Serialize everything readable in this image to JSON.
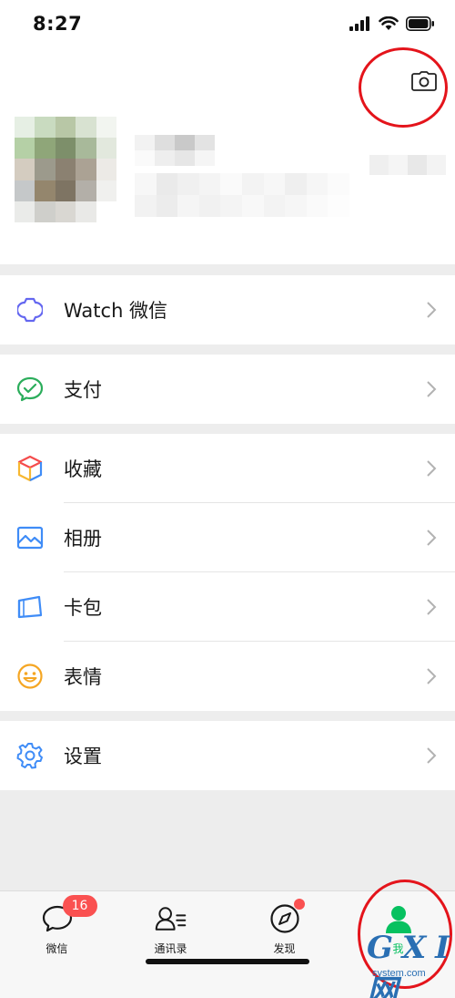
{
  "status_bar": {
    "time": "8:27"
  },
  "menu": {
    "watch": {
      "label": "Watch 微信",
      "icon": "watch-icon"
    },
    "pay": {
      "label": "支付",
      "icon": "pay-icon"
    },
    "favorites": {
      "label": "收藏",
      "icon": "favorites-cube-icon"
    },
    "album": {
      "label": "相册",
      "icon": "album-image-icon"
    },
    "cards": {
      "label": "卡包",
      "icon": "card-wallet-icon"
    },
    "stickers": {
      "label": "表情",
      "icon": "smiley-face-icon"
    },
    "settings": {
      "label": "设置",
      "icon": "gear-icon"
    }
  },
  "tabbar": {
    "chats": {
      "label": "微信",
      "badge": "16"
    },
    "contacts": {
      "label": "通讯录"
    },
    "discover": {
      "label": "发现"
    },
    "me": {
      "label": "我"
    }
  },
  "watermark": {
    "main": "G X I 网",
    "sub": "system.com"
  },
  "colors": {
    "accent_green": "#07c160",
    "badge_red": "#fa5151",
    "annotation_red": "#e4141b",
    "background": "#ededed"
  }
}
